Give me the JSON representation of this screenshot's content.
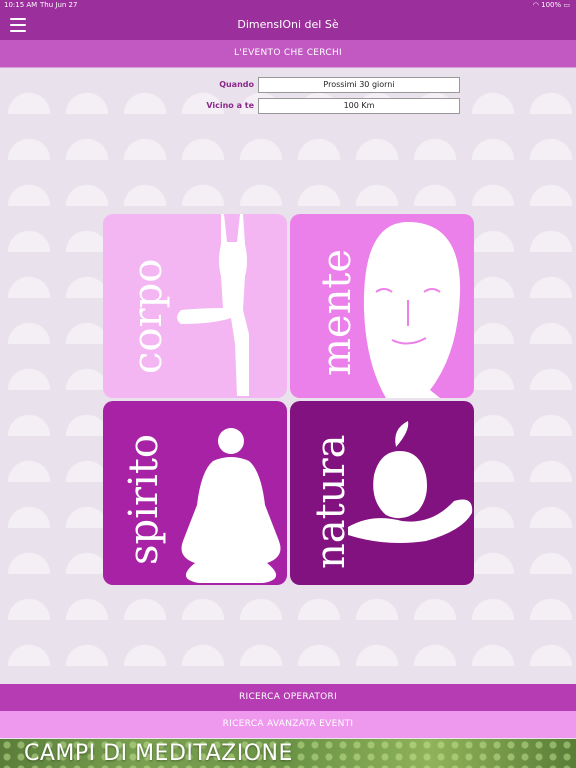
{
  "status": {
    "time": "10:15 AM",
    "date": "Thu Jun 27",
    "battery": "100%"
  },
  "header": {
    "title": "DimensIOni del Sè"
  },
  "subheader": {
    "title": "L'EVENTO CHE CERCHI"
  },
  "filters": {
    "when": {
      "label": "Quando",
      "value": "Prossimi 30 giorni"
    },
    "near": {
      "label": "Vicino a te",
      "value": "100 Km"
    }
  },
  "tiles": {
    "corpo": {
      "label": "corpo",
      "color": "#f4b6f2"
    },
    "mente": {
      "label": "mente",
      "color": "#ec80ea"
    },
    "spirito": {
      "label": "spirito",
      "color": "#a822a6"
    },
    "natura": {
      "label": "natura",
      "color": "#82127f"
    }
  },
  "buttons": {
    "operators": "RICERCA OPERATORI",
    "advanced": "RICERCA AVANZATA EVENTI"
  },
  "colors": {
    "primary": "#9b2f9b",
    "accent": "#c258c2",
    "light": "#ee99ee"
  },
  "banner": {
    "text": "CAMPI DI MEDITAZIONE"
  }
}
